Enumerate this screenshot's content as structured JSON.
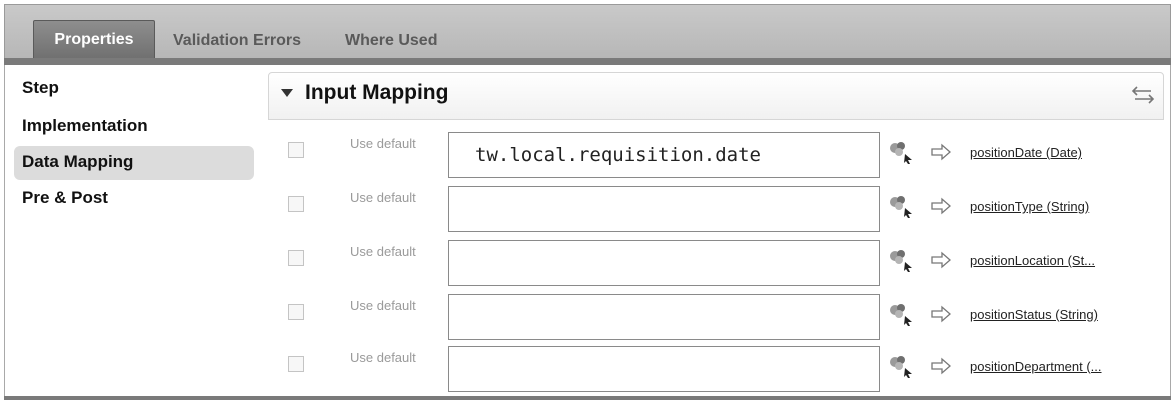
{
  "tabs": [
    {
      "label": "Properties",
      "active": true
    },
    {
      "label": "Validation Errors",
      "active": false
    },
    {
      "label": "Where Used",
      "active": false
    }
  ],
  "sidebar": {
    "items": [
      {
        "label": "Step",
        "selected": false
      },
      {
        "label": "Implementation",
        "selected": false
      },
      {
        "label": "Data Mapping",
        "selected": true
      },
      {
        "label": "Pre & Post",
        "selected": false
      }
    ]
  },
  "section": {
    "title": "Input Mapping",
    "expanded": true,
    "toggle_icon": "swap-arrows-icon"
  },
  "mappings": [
    {
      "use_default_label": "Use default",
      "use_default_checked": false,
      "value": "tw.local.requisition.date",
      "target": "positionDate (Date)"
    },
    {
      "use_default_label": "Use default",
      "use_default_checked": false,
      "value": "",
      "target": "positionType (String)"
    },
    {
      "use_default_label": "Use default",
      "use_default_checked": false,
      "value": "",
      "target": "positionLocation (St..."
    },
    {
      "use_default_label": "Use default",
      "use_default_checked": false,
      "value": "",
      "target": "positionStatus (String)"
    },
    {
      "use_default_label": "Use default",
      "use_default_checked": false,
      "value": "",
      "target": "positionDepartment (..."
    }
  ],
  "icons": {
    "picker": "variable-picker-icon",
    "arrow": "map-arrow-icon"
  }
}
